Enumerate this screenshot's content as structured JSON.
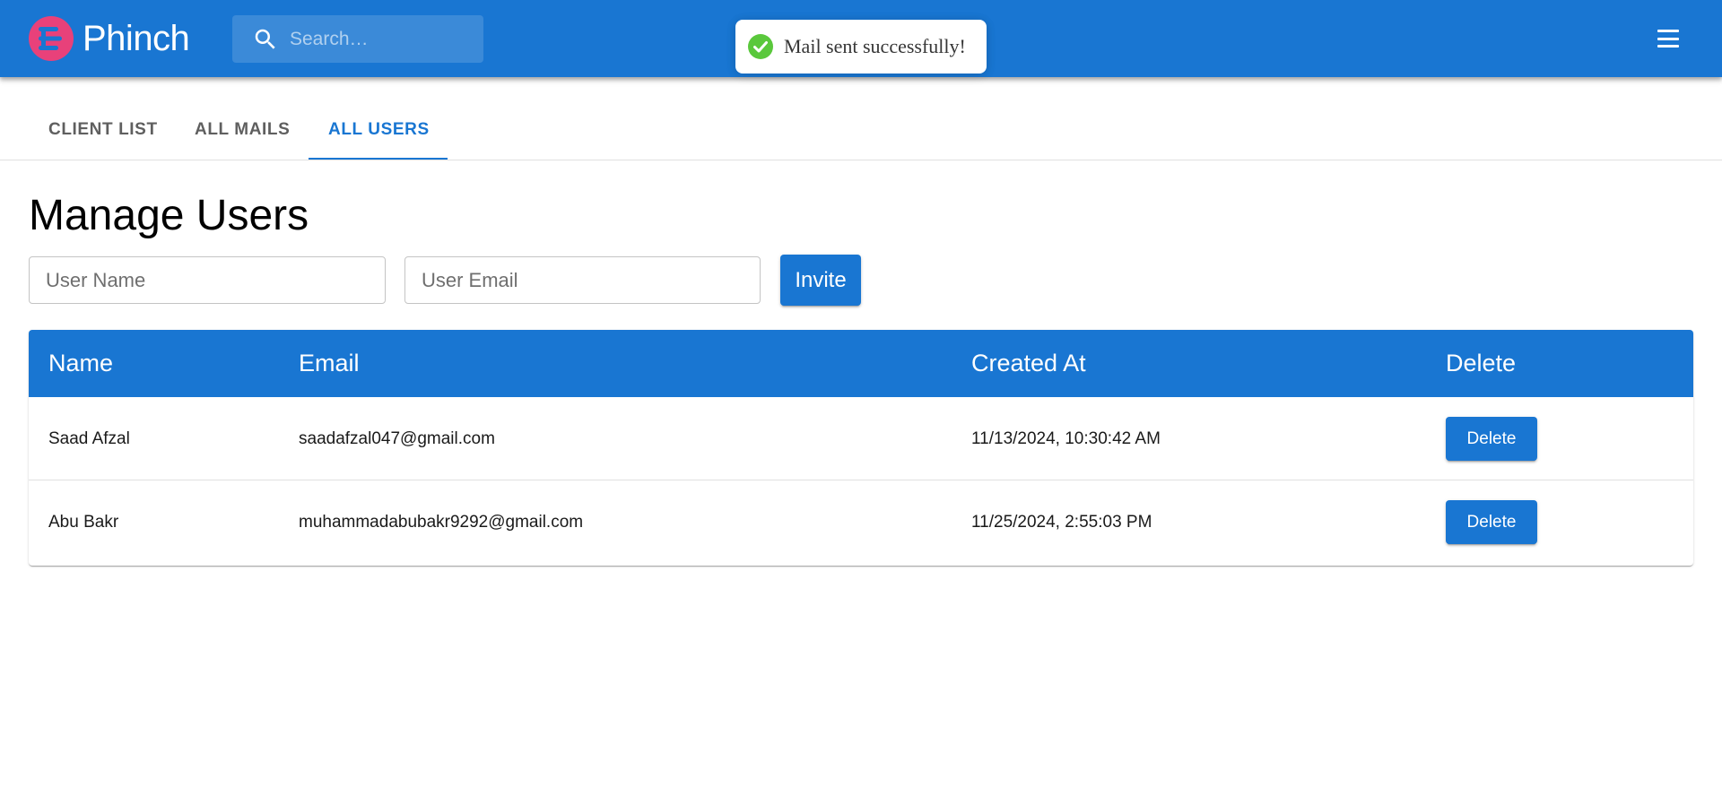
{
  "app": {
    "name": "Phinch",
    "brand_color": "#1976d2",
    "logo_color": "#e8417a"
  },
  "search": {
    "placeholder": "Search…"
  },
  "toast": {
    "message": "Mail sent successfully!",
    "status_color": "#5ac83c"
  },
  "tabs": [
    {
      "label": "CLIENT LIST",
      "active": false
    },
    {
      "label": "ALL MAILS",
      "active": false
    },
    {
      "label": "ALL USERS",
      "active": true
    }
  ],
  "page": {
    "title": "Manage Users"
  },
  "form": {
    "name_placeholder": "User Name",
    "email_placeholder": "User Email",
    "invite_label": "Invite"
  },
  "table": {
    "headers": [
      "Name",
      "Email",
      "Created At",
      "Delete"
    ],
    "rows": [
      {
        "name": "Saad Afzal",
        "email": "saadafzal047@gmail.com",
        "created_at": "11/13/2024, 10:30:42 AM",
        "action": "Delete"
      },
      {
        "name": "Abu Bakr",
        "email": "muhammadabubakr9292@gmail.com",
        "created_at": "11/25/2024, 2:55:03 PM",
        "action": "Delete"
      }
    ]
  },
  "icons": {
    "logo": "phinch-logo-icon",
    "search": "search-icon",
    "menu": "menu-icon",
    "toast": "check-circle-icon"
  }
}
